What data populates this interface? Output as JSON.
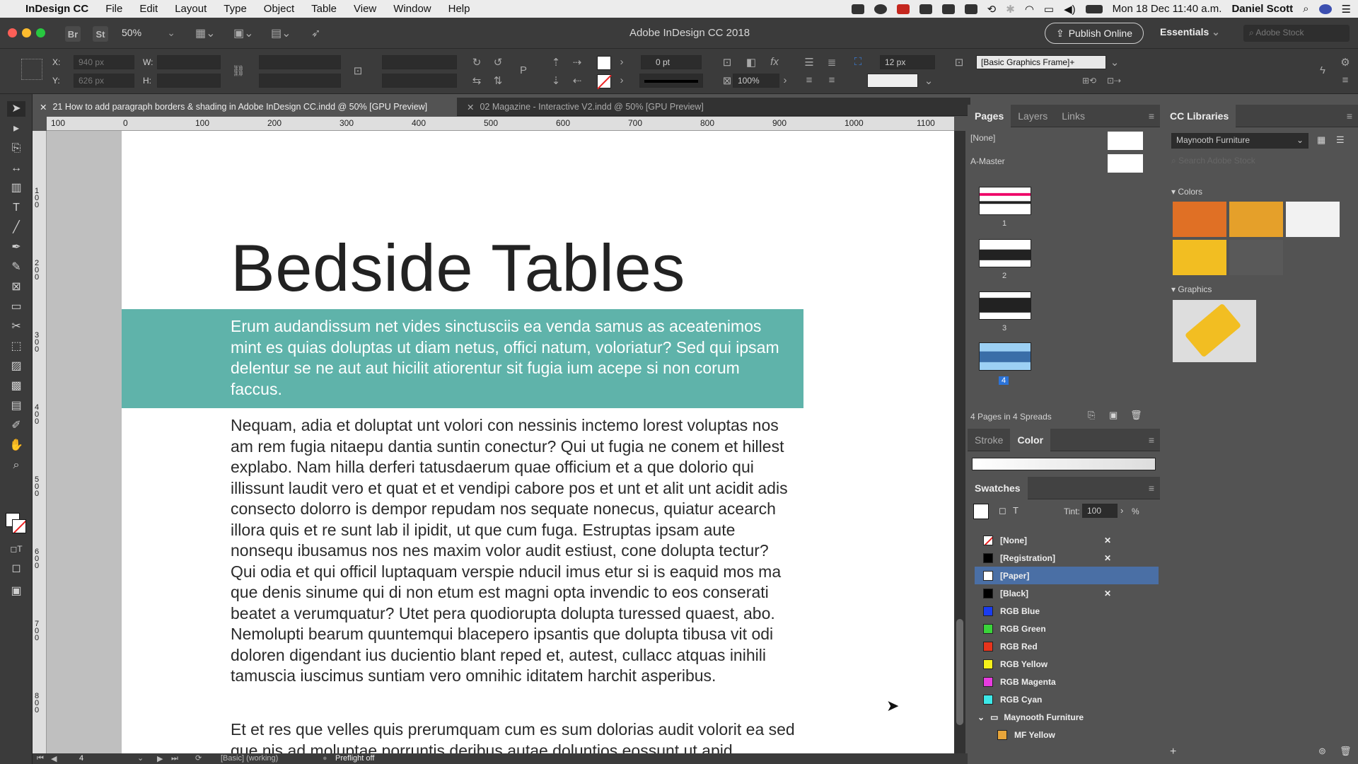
{
  "menubar": {
    "app": "InDesign CC",
    "items": [
      "File",
      "Edit",
      "Layout",
      "Type",
      "Object",
      "Table",
      "View",
      "Window",
      "Help"
    ],
    "clock": "Mon 18 Dec  11:40 a.m.",
    "user": "Daniel Scott"
  },
  "titlebar": {
    "title": "Adobe InDesign CC 2018",
    "br": "Br",
    "st": "St",
    "zoom": "50%",
    "publish": "Publish Online",
    "workspace": "Essentials",
    "stock_placeholder": "Adobe Stock"
  },
  "control": {
    "x_label": "X:",
    "x_value": "940 px",
    "y_label": "Y:",
    "y_value": "626 px",
    "w_label": "W:",
    "h_label": "H:",
    "stroke_weight": "0 pt",
    "scale": "100%",
    "spacing": "12 px",
    "object_style": "[Basic Graphics Frame]+"
  },
  "doctabs": [
    {
      "label": "21 How to add paragraph borders & shading in Adobe InDesign CC.indd @ 50% [GPU Preview]"
    },
    {
      "label": "02 Magazine - Interactive V2.indd @ 50% [GPU Preview]"
    }
  ],
  "ruler": {
    "h_ticks": [
      "100",
      "0",
      "100",
      "200",
      "300",
      "400",
      "500",
      "600",
      "700",
      "800",
      "900",
      "1000",
      "1100"
    ],
    "v_ticks": [
      "100",
      "200",
      "300",
      "400",
      "500",
      "600",
      "700",
      "800"
    ]
  },
  "document": {
    "title": "Bedside Tables",
    "intro": "Erum audandissum net vides sinctusciis ea venda samus as aceatenimos mint es quias doluptas ut diam netus, offici natum, voloriatur? Sed qui ipsam delentur se ne aut aut hicilit atiorentur sit fugia ium acepe si non corum faccus.",
    "body1": "Nequam, adia et doluptat unt volori con nessinis inctemo lorest voluptas nos am rem fugia nitaepu dantia suntin conectur? Qui ut fugia ne conem et hillest explabo. Nam hilla derferi tatusdaerum quae officium et a que dolorio qui illissunt laudit vero et quat et et vendipi cabore pos et unt et alit unt acidit adis consecto dolorro is dempor repudam nos sequate nonecus, quiatur acearch illora quis et re sunt lab il ipidit, ut que cum fuga. Estruptas ipsam aute nonsequ ibusamus nos nes maxim volor audit estiust, cone dolupta tectur? Qui odia et qui officil luptaquam verspie nducil imus etur si is eaquid mos ma que denis sinume qui di non etum est magni opta invendic to eos conserati beatet a verumquatur? Utet pera quodiorupta dolupta turessed quaest, abo. Nemolupti bearum quuntemqui blacepero ipsantis que dolupta tibusa vit odi doloren digendant ius ducientio blant reped et, autest, cullacc atquas inihili tamuscia iuscimus suntiam vero omnihic iditatem harchit asperibus.",
    "body2": "Et et res que velles quis prerumquam cum es sum dolorias audit volorit ea sed que nis ad moluptae porruntis deribus autae doluntios eossunt ut apid"
  },
  "status": {
    "page": "4",
    "style": "[Basic] (working)",
    "preflight": "Preflight off"
  },
  "pages_panel": {
    "tabs": [
      "Pages",
      "Layers",
      "Links"
    ],
    "none_label": "[None]",
    "master_label": "A-Master",
    "page_numbers": [
      "1",
      "2",
      "3",
      "4"
    ],
    "summary": "4 Pages in 4 Spreads"
  },
  "color_panel": {
    "tabs": [
      "Stroke",
      "Color"
    ]
  },
  "swatches_panel": {
    "title": "Swatches",
    "tint_label": "Tint:",
    "tint_value": "100",
    "tint_unit": "%",
    "items": [
      {
        "name": "[None]",
        "color": "#ffffff"
      },
      {
        "name": "[Registration]",
        "color": "#000000"
      },
      {
        "name": "[Paper]",
        "color": "#ffffff"
      },
      {
        "name": "[Black]",
        "color": "#000000"
      },
      {
        "name": "RGB Blue",
        "color": "#1a3cf0"
      },
      {
        "name": "RGB Green",
        "color": "#3ad43a"
      },
      {
        "name": "RGB Red",
        "color": "#e8341c"
      },
      {
        "name": "RGB Yellow",
        "color": "#f5f01a"
      },
      {
        "name": "RGB Magenta",
        "color": "#e83ce0"
      },
      {
        "name": "RGB Cyan",
        "color": "#3ce8e8"
      }
    ],
    "group": "Maynooth Furniture",
    "group_item": {
      "name": "MF Yellow",
      "color": "#e8a53a"
    }
  },
  "cc_libraries": {
    "title": "CC Libraries",
    "library": "Maynooth Furniture",
    "search_placeholder": "Search Adobe Stock",
    "colors_label": "Colors",
    "colors": [
      "#e07025",
      "#e5a02a",
      "#f2f2f2",
      "#f2be22",
      "#595959"
    ],
    "graphics_label": "Graphics"
  },
  "colors": {
    "intro_band": "#5fb3aa",
    "accent": "#3a7bd5"
  }
}
